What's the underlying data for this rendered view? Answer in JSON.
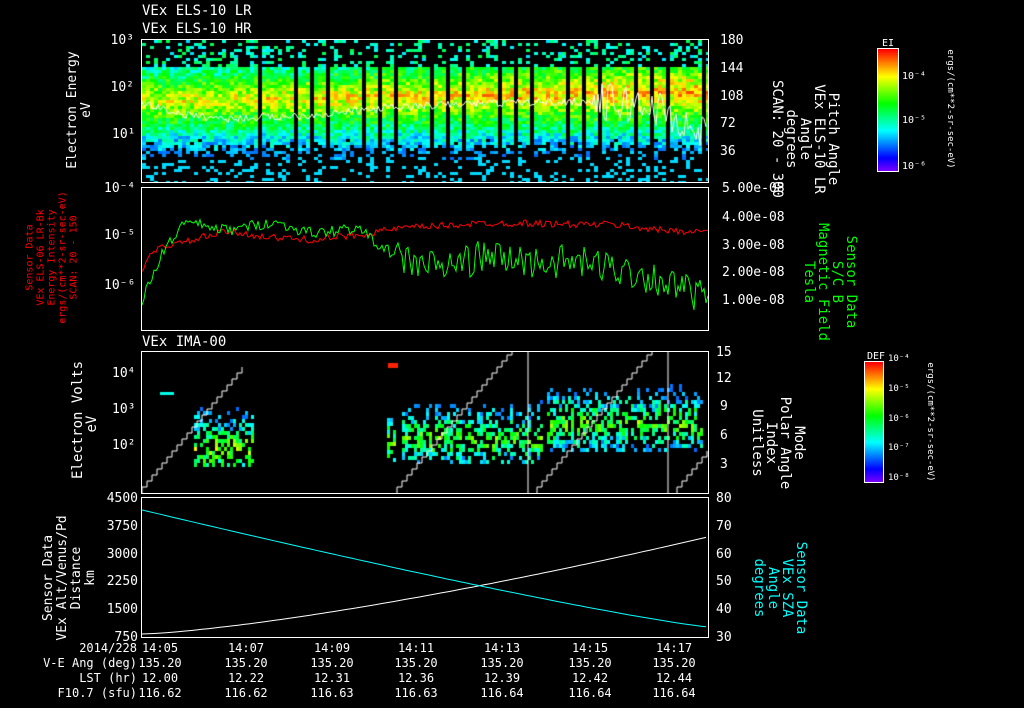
{
  "titles": {
    "p1a": "VEx ELS-10 LR",
    "p1b": "VEx ELS-10 HR",
    "p3": "VEx IMA-00"
  },
  "panel1": {
    "ylabel": [
      "Electron Energy",
      "eV"
    ],
    "yticks": [
      "10³",
      "10²",
      "10¹"
    ],
    "rlabel": [
      "Pitch Angle",
      "VEx ELS-10 LR",
      "Angle",
      "degrees",
      "SCAN: 20 - 300"
    ],
    "rticks": [
      "180",
      "144",
      "108",
      "72",
      "36"
    ],
    "colorbar": {
      "title": "EI",
      "ticks": [
        "10⁻⁴",
        "10⁻⁵",
        "10⁻⁶"
      ],
      "unit": "ergs/(cm**2-sr-sec-eV)"
    }
  },
  "panel2": {
    "ylabel": [
      "Sensor Data",
      "VEx ELS-06 LR-Bk",
      "Energy Intensity",
      "ergs/(cm**2-sr-sec-eV)",
      "SCAN: 20 - 150"
    ],
    "yticks": [
      "10⁻⁴",
      "10⁻⁵",
      "10⁻⁶"
    ],
    "rlabel": [
      "Sensor Data",
      "S/C B",
      "Magnetic Field",
      "Tesla"
    ],
    "rticks": [
      "5.00e-08",
      "4.00e-08",
      "3.00e-08",
      "2.00e-08",
      "1.00e-08"
    ],
    "colors": {
      "left": "#ff0000",
      "right": "#00ff00"
    }
  },
  "panel3": {
    "ylabel": [
      "Electron Volts",
      "eV"
    ],
    "yticks": [
      "10⁴",
      "10³",
      "10²"
    ],
    "rlabel": [
      "Mode",
      "Polar Angle",
      "Index",
      "Unitless"
    ],
    "rticks": [
      "15",
      "12",
      "9",
      "6",
      "3"
    ],
    "colorbar": {
      "title": "DEF",
      "ticks": [
        "10⁻⁴",
        "10⁻⁵",
        "10⁻⁶",
        "10⁻⁷",
        "10⁻⁸"
      ],
      "unit": "ergs/(cm**2-sr-sec-eV)"
    }
  },
  "panel4": {
    "ylabel": [
      "Sensor Data",
      "VEx Alt/Venus/Pd",
      "Distance",
      "km"
    ],
    "yticks": [
      "4500",
      "3750",
      "3000",
      "2250",
      "1500",
      "750"
    ],
    "rlabel": [
      "Sensor Data",
      "VEx SZA",
      "Angle",
      "degrees"
    ],
    "rticks": [
      "80",
      "70",
      "60",
      "50",
      "40",
      "30"
    ],
    "colors": {
      "left": "#ffffff",
      "right": "#00ffff"
    }
  },
  "footer": {
    "labels": [
      "2014/228",
      "V-E Ang (deg)",
      "LST (hr)",
      "F10.7 (sfu)"
    ],
    "times": [
      "14:05",
      "14:07",
      "14:09",
      "14:11",
      "14:13",
      "14:15",
      "14:17"
    ],
    "ve_ang": [
      "135.20",
      "135.20",
      "135.20",
      "135.20",
      "135.20",
      "135.20",
      "135.20"
    ],
    "lst": [
      "12.00",
      "12.22",
      "12.31",
      "12.36",
      "12.39",
      "12.42",
      "12.44"
    ],
    "f107": [
      "116.62",
      "116.62",
      "116.63",
      "116.63",
      "116.64",
      "116.64",
      "116.64"
    ]
  },
  "chart_data": [
    {
      "type": "heatmap",
      "title": "VEx ELS-10 LR / HR",
      "ylabel": "Electron Energy (eV)",
      "ylim": [
        1,
        1000
      ],
      "yscale": "log",
      "x_range": [
        "14:05",
        "14:18"
      ],
      "overlay": {
        "name": "Pitch Angle",
        "ylim": [
          0,
          180
        ],
        "x_min": [
          0,
          1,
          2,
          4,
          6,
          8,
          10,
          11,
          12,
          13
        ],
        "values": [
          100,
          85,
          80,
          85,
          95,
          100,
          102,
          100,
          95,
          60
        ]
      }
    },
    {
      "type": "line",
      "x_min": [
        0,
        0.5,
        1,
        2,
        3,
        4,
        5,
        6,
        7,
        8,
        9,
        10,
        11,
        12,
        13
      ],
      "series": [
        {
          "name": "Energy Intensity",
          "axis": "left",
          "ylim": [
            1e-07,
            0.0001
          ],
          "values": [
            2e-06,
            6e-06,
            7e-06,
            1.2e-05,
            9e-06,
            8e-06,
            1e-05,
            1.4e-05,
            1.6e-05,
            1.8e-05,
            1.8e-05,
            1.7e-05,
            1.7e-05,
            1.3e-05,
            1.2e-05
          ]
        },
        {
          "name": "S/C B (Tesla)",
          "axis": "right",
          "ylim": [
            0,
            5e-08
          ],
          "values": [
            1e-08,
            2.8e-08,
            3.8e-08,
            3.5e-08,
            3.8e-08,
            3.4e-08,
            3.6e-08,
            2.5e-08,
            2.2e-08,
            2.6e-08,
            2.4e-08,
            2.4e-08,
            2.2e-08,
            1.8e-08,
            1.2e-08
          ]
        }
      ]
    },
    {
      "type": "heatmap",
      "title": "VEx IMA-00",
      "ylabel": "Electron Volts (eV)",
      "ylim": [
        10,
        50000
      ],
      "yscale": "log",
      "overlay": {
        "name": "Polar Angle Index",
        "ylim": [
          0,
          15
        ]
      }
    },
    {
      "type": "line",
      "x_min": [
        0,
        13.2
      ],
      "series": [
        {
          "name": "VEx Alt/Venus/Pd (km)",
          "axis": "left",
          "ylim": [
            750,
            4500
          ],
          "values": [
            830,
            3450
          ]
        },
        {
          "name": "VEx SZA (degrees)",
          "axis": "right",
          "ylim": [
            30,
            80
          ],
          "values": [
            75.7,
            33.6
          ]
        }
      ]
    }
  ]
}
